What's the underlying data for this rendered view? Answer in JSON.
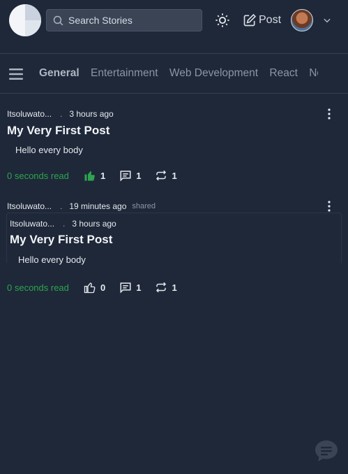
{
  "header": {
    "search_placeholder": "Search Stories",
    "post_label": "Post"
  },
  "categories": [
    "General",
    "Entertainment",
    "Web Development",
    "React",
    "Noc"
  ],
  "posts": [
    {
      "author": "Itsoluwato...",
      "separator": ".",
      "time": "3 hours ago",
      "title": "My Very First Post",
      "body": "Hello every body",
      "read_time": "0 seconds read",
      "likes": "1",
      "comments": "1",
      "reposts": "1"
    },
    {
      "author": "Itsoluwato...",
      "separator": ".",
      "time": "19 minutes ago",
      "shared_label": "shared",
      "shared_post": {
        "author": "Itsoluwato...",
        "separator": ".",
        "time": "3 hours ago",
        "title": "My Very First Post",
        "body": "Hello every body"
      },
      "read_time": "0 seconds read",
      "likes": "0",
      "comments": "1",
      "reposts": "1"
    }
  ],
  "colors": {
    "background": "#1e2839",
    "accent_green": "#2ea44f",
    "muted_text": "#8b95a5"
  }
}
